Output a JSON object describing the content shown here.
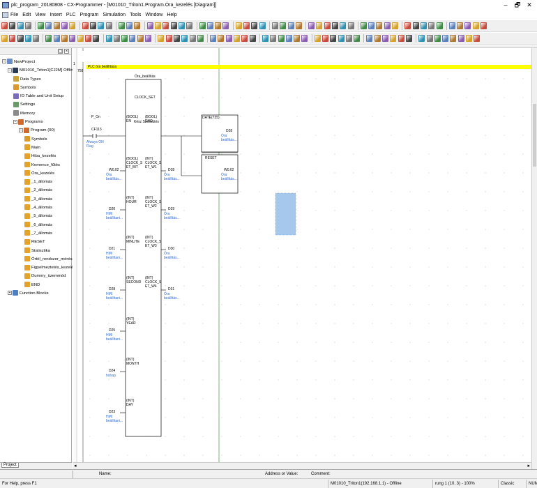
{
  "window": {
    "title": "plc_program_20180808 - CX-Programmer - [M01010_Triton1.Program.Óra_kezelés [Diagram]]",
    "controls": [
      "–",
      "🗗",
      "✕"
    ]
  },
  "menu": [
    "File",
    "Edit",
    "View",
    "Insert",
    "PLC",
    "Program",
    "Simulation",
    "Tools",
    "Window",
    "Help"
  ],
  "tree": [
    {
      "label": "NewProject",
      "level": 0,
      "expander": "−",
      "icon": "project-icon"
    },
    {
      "label": "M01010_Triton1[CJ2M] Offline",
      "level": 1,
      "expander": "−",
      "icon": "plc-icon"
    },
    {
      "label": "Data Types",
      "level": 2,
      "icon": "data-types-icon"
    },
    {
      "label": "Symbols",
      "level": 2,
      "icon": "symbols-icon"
    },
    {
      "label": "IO Table and Unit Setup",
      "level": 2,
      "icon": "io-table-icon"
    },
    {
      "label": "Settings",
      "level": 2,
      "icon": "settings-icon"
    },
    {
      "label": "Memory",
      "level": 2,
      "icon": "memory-icon"
    },
    {
      "label": "Programs",
      "level": 2,
      "expander": "−",
      "icon": "programs-icon"
    },
    {
      "label": "Program (00)",
      "level": 3,
      "expander": "−",
      "icon": "program-icon"
    },
    {
      "label": "Symbols",
      "level": 4,
      "icon": "symbols-icon"
    },
    {
      "label": "Main",
      "level": 4,
      "icon": "section-icon"
    },
    {
      "label": "Hiba_kezelés",
      "level": 4,
      "icon": "section-icon"
    },
    {
      "label": "Kemence_fűtés",
      "level": 4,
      "icon": "section-icon"
    },
    {
      "label": "Óra_kezelés",
      "level": 4,
      "icon": "section-icon"
    },
    {
      "label": "_1_állomás",
      "level": 4,
      "icon": "section-icon"
    },
    {
      "label": "_2_állomás",
      "level": 4,
      "icon": "section-icon"
    },
    {
      "label": "_3_állomás",
      "level": 4,
      "icon": "section-icon"
    },
    {
      "label": "_4_állomás",
      "level": 4,
      "icon": "section-icon"
    },
    {
      "label": "_5_állomás",
      "level": 4,
      "icon": "section-icon"
    },
    {
      "label": "_6_állomás",
      "level": 4,
      "icon": "section-icon"
    },
    {
      "label": "_7_állomás",
      "level": 4,
      "icon": "section-icon"
    },
    {
      "label": "RESET",
      "level": 4,
      "icon": "section-icon"
    },
    {
      "label": "Statisztika",
      "level": 4,
      "icon": "section-icon"
    },
    {
      "label": "Órtól_rendszer_mérése",
      "level": 4,
      "icon": "section-icon"
    },
    {
      "label": "Figyelmeztetés_kezelés",
      "level": 4,
      "icon": "section-icon"
    },
    {
      "label": "Dummy_üzemmód",
      "level": 4,
      "icon": "section-icon"
    },
    {
      "label": "END",
      "level": 4,
      "icon": "section-icon"
    },
    {
      "label": "Function Blocks",
      "level": 1,
      "expander": "+",
      "icon": "function-blocks-icon"
    }
  ],
  "panel_tab": "Project",
  "diagram": {
    "rung_number": "1",
    "step_number": "758",
    "rung_comment": "PLC óra beállítása",
    "fb_instance": "Óra_beállítás",
    "fb_name": "CLOCK_SET",
    "contact": {
      "symbol": "P_On",
      "address": "CF113",
      "comment": "Always ON Flag"
    },
    "fb_inputs": [
      {
        "type": "(BOOL)",
        "name": "EN",
        "operand": "",
        "comment": ""
      },
      {
        "type": "(BOOL)",
        "name": "CLOCK_S ET_BIT",
        "operand": "W0.02",
        "comment": "Óra beállítás..."
      },
      {
        "type": "(INT)",
        "name": "HOUR",
        "operand": "D20",
        "comment": "HMI beállítani..."
      },
      {
        "type": "(INT)",
        "name": "MINUTE",
        "operand": "D21",
        "comment": "HMI beállítani..."
      },
      {
        "type": "(INT)",
        "name": "SECOND",
        "operand": "D28",
        "comment": "HMI beállítani..."
      },
      {
        "type": "(INT)",
        "name": "YEAR",
        "operand": "D25",
        "comment": "HMI beállítani..."
      },
      {
        "type": "(INT)",
        "name": "MONTH",
        "operand": "D24",
        "comment": "hónap"
      },
      {
        "type": "(INT)",
        "name": "DAY",
        "operand": "D23",
        "comment": "HMI beállítani..."
      }
    ],
    "fb_outputs": [
      {
        "type": "(BOOL)",
        "name": "ENO",
        "operand": "",
        "comment": ""
      },
      {
        "type": "(INT)",
        "name": "CLOCK_S ET_W1",
        "operand": "D28",
        "comment": "Óra beállítás..."
      },
      {
        "type": "(INT)",
        "name": "CLOCK_S ET_W2",
        "operand": "D29",
        "comment": "Óra beállítás..."
      },
      {
        "type": "(INT)",
        "name": "CLOCK_S ET_W3",
        "operand": "D30",
        "comment": "Óra beállítás..."
      },
      {
        "type": "(INT)",
        "name": "CLOCK_S ET_W4",
        "operand": "D31",
        "comment": "Óra beállítás..."
      }
    ],
    "en_text": "Kész Szebsütés",
    "instr_date": {
      "name": "DATE(735)",
      "operand": "D28",
      "comment": "Óra beállítás..."
    },
    "instr_reset": {
      "name": "RESET",
      "operand": "W0.02",
      "comment": "Óra beállítás..."
    }
  },
  "namebar": {
    "name_label": "Name:",
    "address_label": "Address or Value:",
    "comment_label": "Comment:"
  },
  "status": {
    "help": "For Help, press F1",
    "connection": "M01010_Triton1(192.168.1.1) - Offline",
    "position": "rung 1 (10, 3)  - 100%",
    "mode": "Classic",
    "num": "NUM"
  },
  "colors": {
    "rung_comment_bg": "#ffff00",
    "comment_text": "#2e6bd4",
    "selection": "#a5c8ec",
    "power_rail": "#5aa05a"
  }
}
